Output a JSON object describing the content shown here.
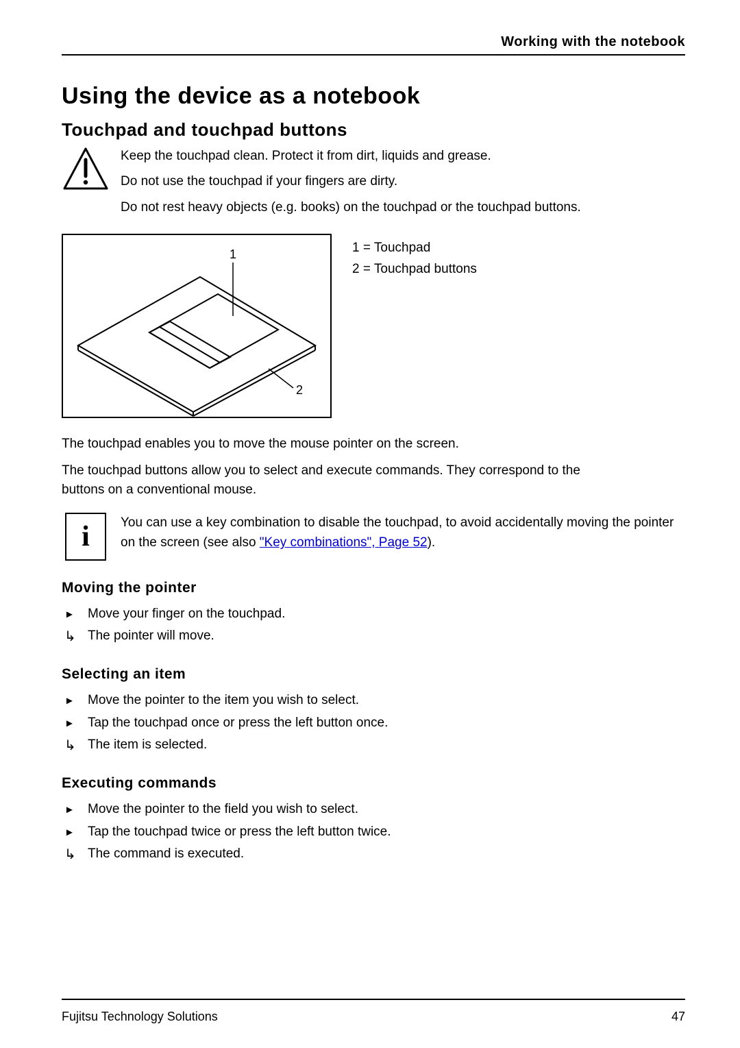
{
  "header": {
    "running_head": "Working with the notebook"
  },
  "titles": {
    "h1": "Using the device as a notebook",
    "h2": "Touchpad and touchpad buttons",
    "h3_moving": "Moving the pointer",
    "h3_selecting": "Selecting an item",
    "h3_executing": "Executing commands"
  },
  "caution": {
    "p1": "Keep the touchpad clean. Protect it from dirt, liquids and grease.",
    "p2": "Do not use the touchpad if your fingers are dirty.",
    "p3": "Do not rest heavy objects (e.g. books) on the touchpad or the touchpad buttons."
  },
  "diagram": {
    "callout1": "1",
    "callout2": "2",
    "legend1": "1 = Touchpad",
    "legend2": "2 = Touchpad buttons"
  },
  "body": {
    "p1": "The touchpad enables you to move the mouse pointer on the screen.",
    "p2": "The touchpad buttons allow you to select and execute commands. They correspond to the buttons on a conventional mouse."
  },
  "info_note": {
    "text_before_link": "You can use a key combination to disable the touchpad, to avoid accidentally moving the pointer on the screen (see also ",
    "link_text": "\"Key combinations\", Page 52",
    "text_after_link": ")."
  },
  "moving": {
    "s1": "Move your finger on the touchpad.",
    "r1": "The pointer will move."
  },
  "selecting": {
    "s1": "Move the pointer to the item you wish to select.",
    "s2": "Tap the touchpad once or press the left button once.",
    "r1": "The item is selected."
  },
  "executing": {
    "s1": "Move the pointer to the field you wish to select.",
    "s2": "Tap the touchpad twice or press the left button twice.",
    "r1": "The command is executed."
  },
  "footer": {
    "left": "Fujitsu Technology Solutions",
    "page": "47"
  }
}
